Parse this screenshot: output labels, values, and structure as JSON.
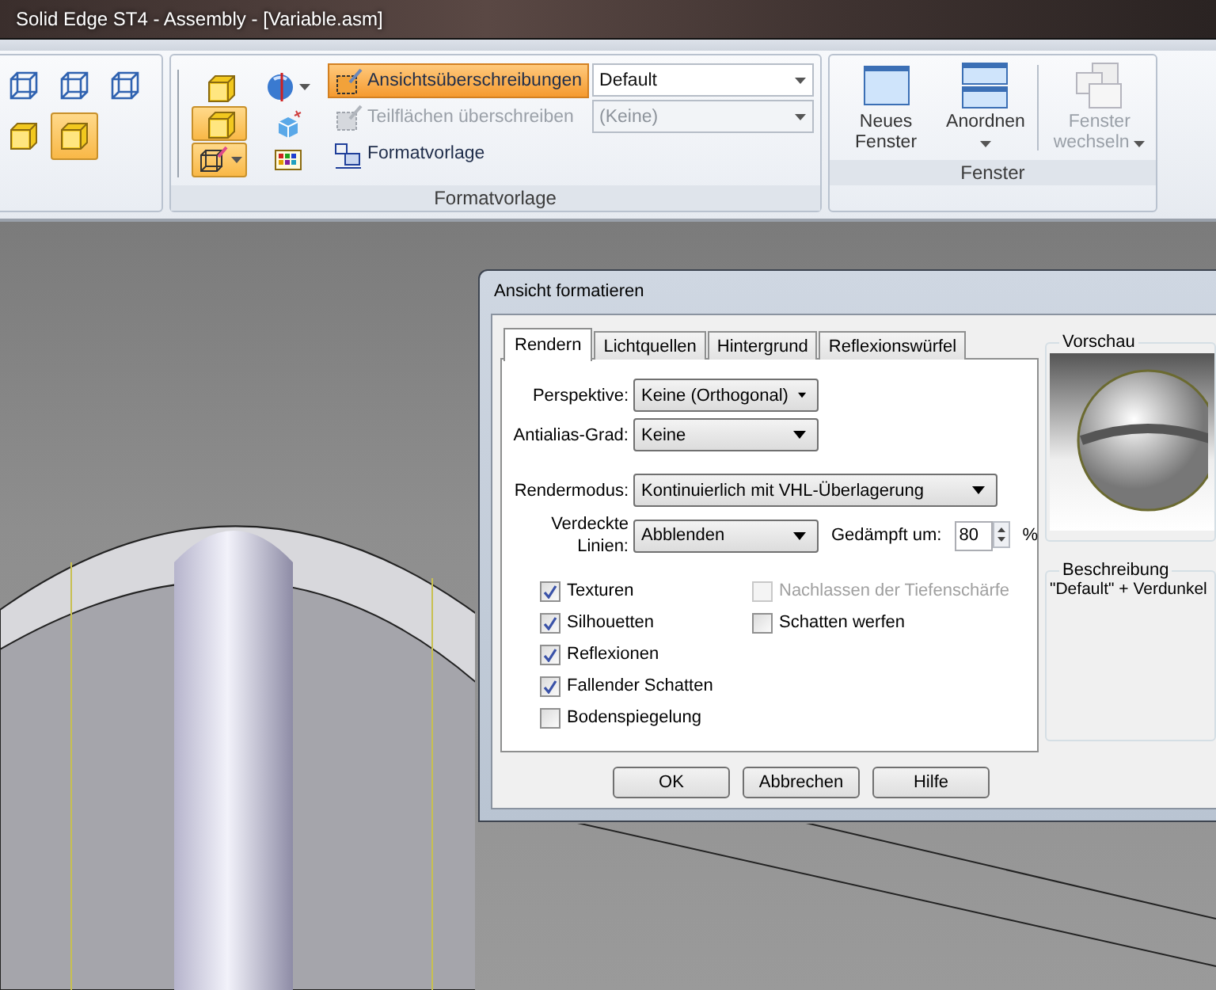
{
  "window": {
    "title": "Solid Edge ST4 - Assembly - [Variable.asm]"
  },
  "ribbon": {
    "view_styles": [
      {
        "kind": "wireframe",
        "selected": false
      },
      {
        "kind": "wireframe",
        "selected": false
      },
      {
        "kind": "wireframe",
        "selected": false
      },
      {
        "kind": "shaded",
        "selected": false
      },
      {
        "kind": "shaded",
        "selected": true
      }
    ],
    "style_group": {
      "label": "Formatvorlage",
      "tools": [
        {
          "kind": "shaded",
          "selected": false
        },
        {
          "kind": "sphere",
          "selected": false
        },
        {
          "kind": "shaded",
          "selected": true
        },
        {
          "kind": "light",
          "selected": false
        },
        {
          "kind": "edit",
          "selected": true
        },
        {
          "kind": "palette",
          "selected": false
        }
      ],
      "commands": [
        {
          "label": "Ansichtsüberschreibungen",
          "highlighted": true,
          "disabled": false,
          "dropdown": "Default"
        },
        {
          "label": "Teilflächen überschreiben",
          "highlighted": false,
          "disabled": true,
          "dropdown": "(Keine)"
        },
        {
          "label": "Formatvorlage",
          "highlighted": false,
          "disabled": false
        }
      ]
    },
    "window_group": {
      "label": "Fenster",
      "commands": [
        {
          "label": "Neues Fenster",
          "kind": "single",
          "disabled": false,
          "dropdown": false
        },
        {
          "label": "Anordnen",
          "kind": "split",
          "disabled": false,
          "dropdown": true
        },
        {
          "label": "Fenster wechseln",
          "kind": "stack",
          "disabled": true,
          "dropdown": true
        }
      ]
    }
  },
  "dialog": {
    "title": "Ansicht formatieren",
    "tabs": [
      {
        "label": "Rendern",
        "selected": true
      },
      {
        "label": "Lichtquellen",
        "selected": false
      },
      {
        "label": "Hintergrund",
        "selected": false
      },
      {
        "label": "Reflexionswürfel",
        "selected": false
      }
    ],
    "fields": [
      {
        "label": "Perspektive:",
        "value": "Keine (Orthogonal)",
        "kind": "short"
      },
      {
        "label": "Antialias-Grad:",
        "value": "Keine",
        "kind": "short"
      },
      {
        "label": "Rendermodus:",
        "value": "Kontinuierlich mit VHL-Überlagerung",
        "kind": "long"
      },
      {
        "label": "Verdeckte Linien:",
        "value": "Abblenden",
        "kind": "short"
      }
    ],
    "dimming": {
      "label": "Gedämpft um:",
      "value": "80",
      "unit": "%"
    },
    "checkboxes_left": [
      {
        "label": "Texturen",
        "checked": true,
        "disabled": false
      },
      {
        "label": "Silhouetten",
        "checked": true,
        "disabled": false
      },
      {
        "label": "Reflexionen",
        "checked": true,
        "disabled": false
      },
      {
        "label": "Fallender Schatten",
        "checked": true,
        "disabled": false
      },
      {
        "label": "Bodenspiegelung",
        "checked": false,
        "disabled": false
      }
    ],
    "checkboxes_right": [
      {
        "label": "Nachlassen der Tiefenschärfe",
        "checked": false,
        "disabled": true
      },
      {
        "label": "Schatten werfen",
        "checked": false,
        "disabled": false
      }
    ],
    "preview": {
      "label": "Vorschau"
    },
    "description": {
      "label": "Beschreibung",
      "text": "\"Default\" + Verdunkel"
    },
    "buttons": [
      "OK",
      "Abbrechen",
      "Hilfe"
    ]
  }
}
